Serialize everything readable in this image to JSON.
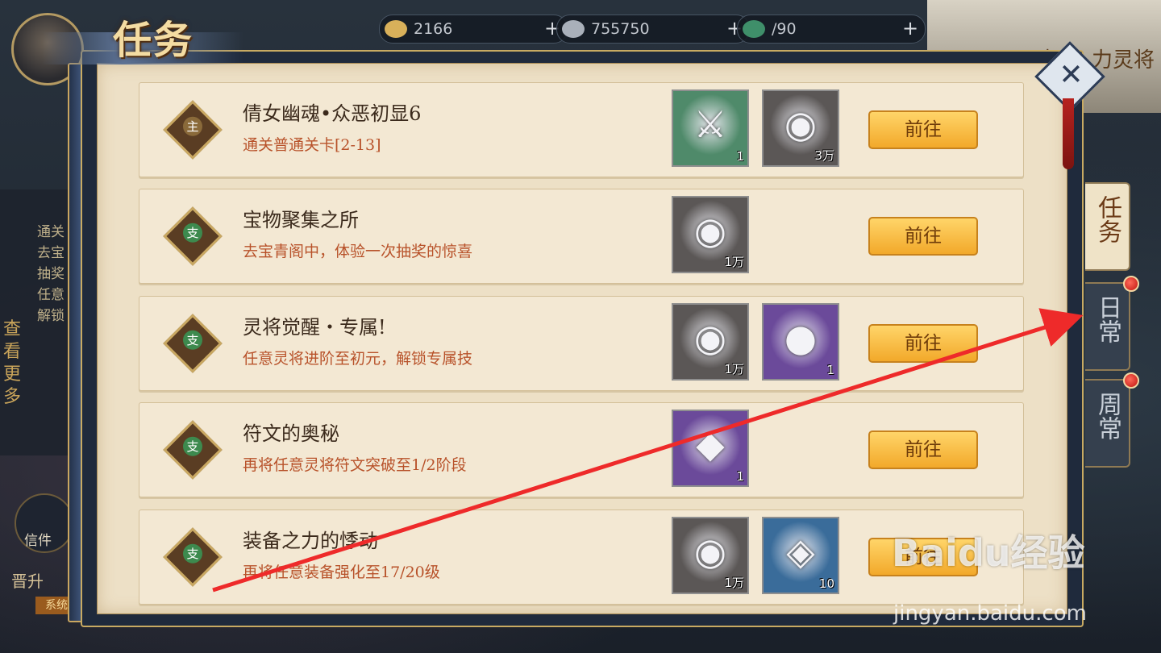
{
  "topbar": {
    "resources": [
      {
        "name": "gold-ingot",
        "value": "2166"
      },
      {
        "name": "silver-ingot",
        "value": "755750"
      },
      {
        "name": "stamina",
        "value": "/90"
      }
    ]
  },
  "panel": {
    "title": "任务",
    "close_label": "✕"
  },
  "tabs": [
    {
      "label": "任务",
      "active": true
    },
    {
      "label": "日常",
      "active": false,
      "has_alert": true
    },
    {
      "label": "周常",
      "active": false,
      "has_alert": true
    }
  ],
  "tasks": [
    {
      "badge": "主",
      "title": "倩女幽魂•众恶初显6",
      "desc": "通关普通关卡[2-13]",
      "rewards": [
        {
          "icon": "equipment-greave-icon",
          "count": "1",
          "bg": "#4f8a6a"
        },
        {
          "icon": "silver-ingot-icon",
          "count": "3万",
          "bg": "#5b5756"
        }
      ],
      "button": "前往"
    },
    {
      "badge": "支",
      "title": "宝物聚集之所",
      "desc": "去宝青阁中，体验一次抽奖的惊喜",
      "rewards": [
        {
          "icon": "silver-ingot-icon",
          "count": "1万",
          "bg": "#5b5756"
        }
      ],
      "button": "前往"
    },
    {
      "badge": "支",
      "title": "灵将觉醒・专属!",
      "desc": "任意灵将进阶至初元，解锁专属技",
      "rewards": [
        {
          "icon": "silver-ingot-icon",
          "count": "1万",
          "bg": "#5b5756"
        },
        {
          "icon": "purple-orb-chest-icon",
          "count": "1",
          "bg": "#6b4a9a"
        }
      ],
      "button": "前往"
    },
    {
      "badge": "支",
      "title": "符文的奥秘",
      "desc": "再将任意灵将符文突破至1/2阶段",
      "rewards": [
        {
          "icon": "rune-chest-icon",
          "count": "1",
          "bg": "#6b4a9a"
        }
      ],
      "button": "前往"
    },
    {
      "badge": "支",
      "title": "装备之力的悸动",
      "desc": "再将任意装备强化至17/20级",
      "rewards": [
        {
          "icon": "silver-ingot-icon",
          "count": "1万",
          "bg": "#5b5756"
        },
        {
          "icon": "blue-crystal-icon",
          "count": "10",
          "bg": "#3a6c9a"
        }
      ],
      "button": "前往"
    }
  ],
  "left_panel": {
    "more_label": "查看更多",
    "ghost_items": [
      "通关",
      "去宝",
      "抽奖",
      "任意",
      "解锁"
    ],
    "mail_label": "信件",
    "promote_label": "晋升",
    "system_tag": "系统",
    "promote_bottom": "晋升到"
  },
  "right_banner": {
    "text": "好礼 力灵将"
  },
  "watermark": {
    "brand": "Baidu经验",
    "url": "jingyan.baidu.com"
  },
  "colors": {
    "accent_gold": "#c9a862",
    "desc_text": "#b8522a",
    "button": "#f2a92a"
  }
}
